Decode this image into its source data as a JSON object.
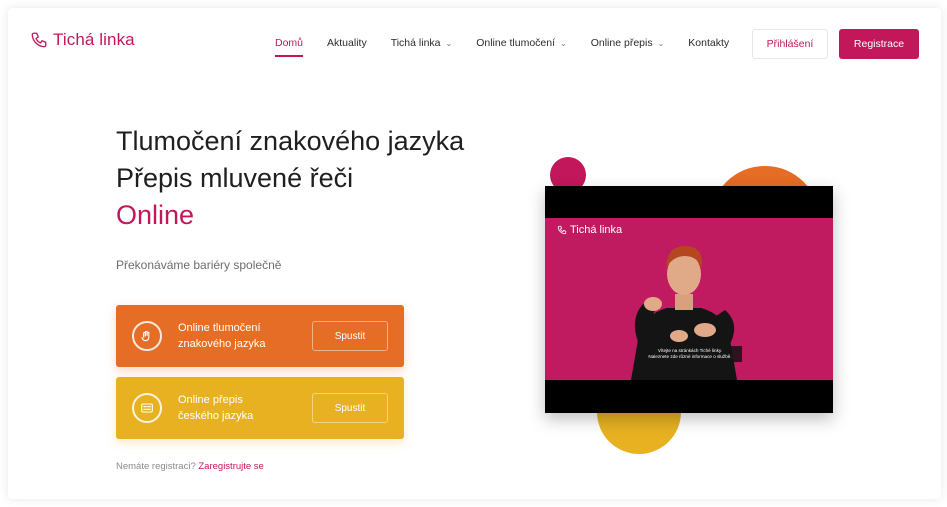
{
  "header": {
    "logo_text": "Tichá linka",
    "nav": [
      {
        "label": "Domů"
      },
      {
        "label": "Aktuality"
      },
      {
        "label": "Tichá linka"
      },
      {
        "label": "Online tlumočení"
      },
      {
        "label": "Online přepis"
      },
      {
        "label": "Kontakty"
      }
    ],
    "login_label": "Přihlášení",
    "register_label": "Registrace"
  },
  "hero": {
    "line1": "Tlumočení znakového jazyka",
    "line2": "Přepis mluvené řeči",
    "line3": "Online",
    "subtitle": "Překonáváme bariéry společně"
  },
  "cards": [
    {
      "title_line1": "Online tlumočení",
      "title_line2": "znakového jazyka",
      "button": "Spustit",
      "icon": "hands-icon",
      "color": "#e56d25"
    },
    {
      "title_line1": "Online přepis",
      "title_line2": "českého jazyka",
      "button": "Spustit",
      "icon": "transcript-icon",
      "color": "#e7b122"
    }
  ],
  "signup": {
    "question": "Nemáte registraci?",
    "link": "Zaregistrujte se"
  },
  "video": {
    "logo_text": "Tichá linka",
    "caption_line1": "Vítejte na stránkách Tiché linky.",
    "caption_line2": "Naleznete zde různé informace o službě."
  },
  "colors": {
    "brand": "#c2185b",
    "orange": "#e56d25",
    "yellow": "#e7b122"
  }
}
